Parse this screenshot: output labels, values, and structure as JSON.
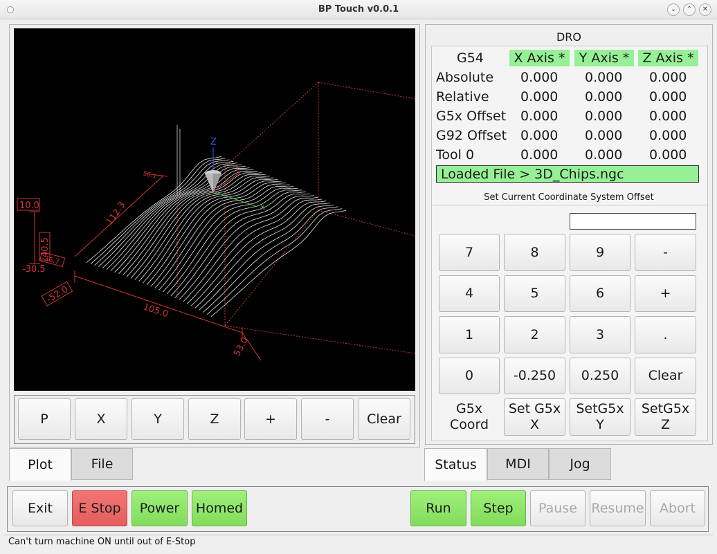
{
  "window": {
    "title": "BP Touch v0.0.1"
  },
  "plot_buttons": [
    "P",
    "X",
    "Y",
    "Z",
    "+",
    "-",
    "Clear"
  ],
  "left_tabs": [
    "Plot",
    "File"
  ],
  "plot_labels": {
    "z_axis": "Z",
    "y_axis": "Y",
    "x_axis": "X",
    "dim_top": "56.1",
    "dim_left": "112.3",
    "dim_front": "105.0",
    "dim_right": "53.0",
    "box1": "10.0",
    "box2": "40.5",
    "box3": "-30.5",
    "box4": "-52.0",
    "small_label": "-36.7"
  },
  "dro": {
    "title": "DRO",
    "coord_system": "G54",
    "axes": [
      "X Axis *",
      "Y Axis *",
      "Z Axis *"
    ],
    "rows": [
      {
        "label": "Absolute",
        "values": [
          "0.000",
          "0.000",
          "0.000"
        ]
      },
      {
        "label": "Relative",
        "values": [
          "0.000",
          "0.000",
          "0.000"
        ]
      },
      {
        "label": "G5x Offset",
        "values": [
          "0.000",
          "0.000",
          "0.000"
        ]
      },
      {
        "label": "G92 Offset",
        "values": [
          "0.000",
          "0.000",
          "0.000"
        ]
      },
      {
        "label": "Tool 0",
        "values": [
          "0.000",
          "0.000",
          "0.000"
        ]
      }
    ],
    "loaded_file": "Loaded File > 3D_Chips.ngc"
  },
  "offset_panel": {
    "title": "Set Current Coordinate System Offset",
    "entry_value": "",
    "keys": [
      [
        "7",
        "8",
        "9",
        "-"
      ],
      [
        "4",
        "5",
        "6",
        "+"
      ],
      [
        "1",
        "2",
        "3",
        "."
      ],
      [
        "0",
        "-0.250",
        "0.250",
        "Clear"
      ]
    ],
    "coord_label": "G5x\nCoord",
    "set_buttons": [
      "Set G5x\nX",
      "SetG5x\nY",
      "SetG5x\nZ"
    ]
  },
  "right_tabs": [
    "Status",
    "MDI",
    "Jog"
  ],
  "bottom_buttons": {
    "exit": "Exit",
    "estop": "E Stop",
    "power": "Power",
    "homed": "Homed",
    "run": "Run",
    "step": "Step",
    "pause": "Pause",
    "resume": "Resume",
    "abort": "Abort"
  },
  "status_message": "Can't turn machine ON until out of E-Stop",
  "colors": {
    "green": "#96f096",
    "estop_red": "#e45e5e",
    "plot_bg": "#000000"
  }
}
